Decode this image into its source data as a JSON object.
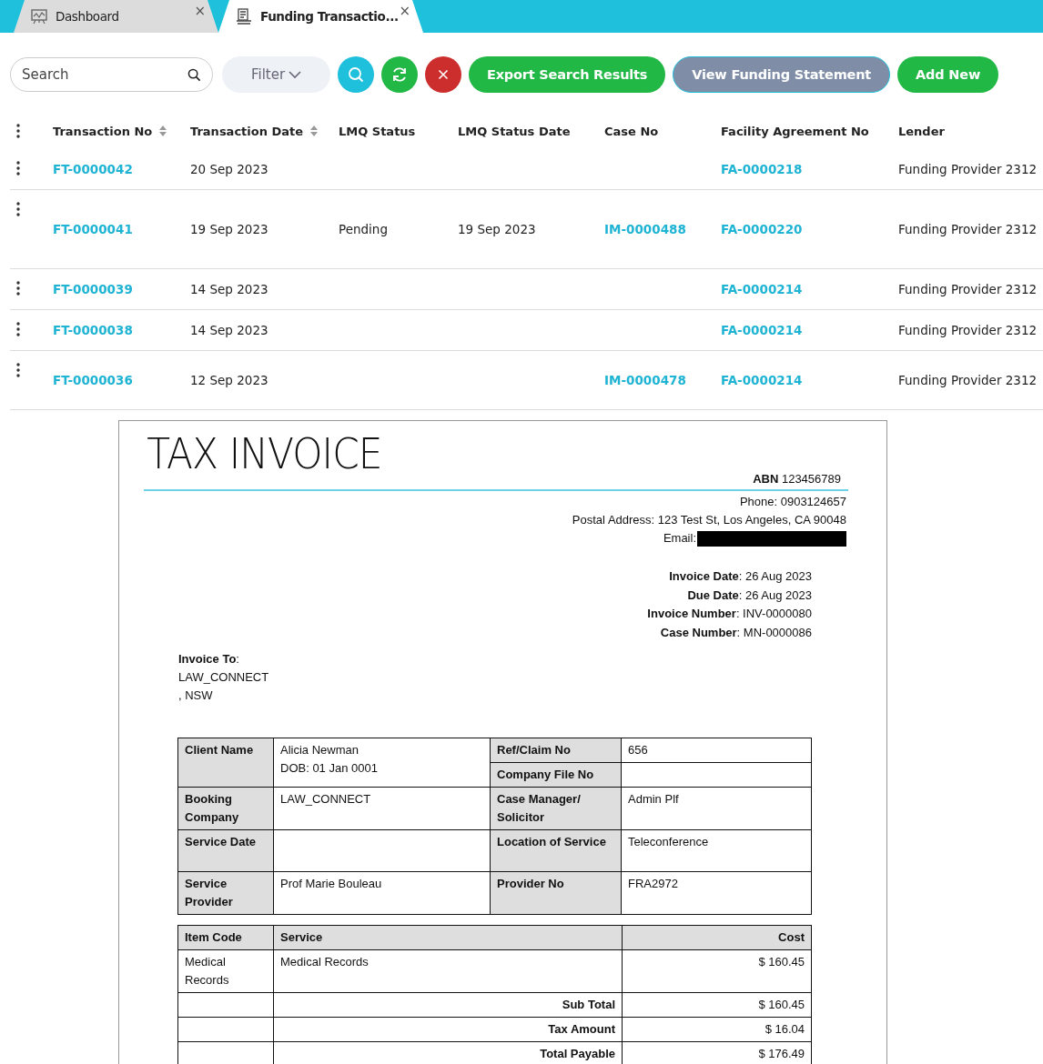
{
  "tabs": [
    {
      "label": "Dashboard",
      "close": "×",
      "selected": false
    },
    {
      "label": "Funding Transactio...",
      "close": "×",
      "selected": true
    }
  ],
  "toolbar": {
    "search": {
      "placeholder": "Search"
    },
    "filter": "Filter",
    "buttons": [
      {
        "label": "Export Search Results",
        "kind": "green"
      },
      {
        "label": "View Funding Statement",
        "kind": "grey"
      },
      {
        "label": "Add New",
        "kind": "green"
      }
    ]
  },
  "table": {
    "columns": [
      {
        "label": "Transaction No",
        "sortable": true
      },
      {
        "label": "Transaction Date",
        "sortable": true
      },
      {
        "label": "LMQ Status",
        "sortable": false
      },
      {
        "label": "LMQ Status Date",
        "sortable": false
      },
      {
        "label": "Case No",
        "sortable": false
      },
      {
        "label": "Facility Agreement No",
        "sortable": false
      },
      {
        "label": "Lender",
        "sortable": false
      }
    ],
    "rows": [
      {
        "transaction_no": "FT-0000042",
        "transaction_date": "20 Sep 2023",
        "facility_agreement_no": "FA-0000218",
        "lender": "Funding Provider 2312"
      },
      {
        "transaction_no": "FT-0000041",
        "transaction_date": "19 Sep 2023",
        "lmq_status": "Pending",
        "lmq_status_date": "19 Sep 2023",
        "case_no": "IM-0000488",
        "facility_agreement_no": "FA-0000220",
        "lender": "Funding Provider 2312"
      },
      {
        "transaction_no": "FT-0000039",
        "transaction_date": "14 Sep 2023",
        "facility_agreement_no": "FA-0000214",
        "lender": "Funding Provider 2312"
      },
      {
        "transaction_no": "FT-0000038",
        "transaction_date": "14 Sep 2023",
        "facility_agreement_no": "FA-0000214",
        "lender": "Funding Provider 2312"
      },
      {
        "transaction_no": "FT-0000036",
        "transaction_date": "12 Sep 2023",
        "case_no": "IM-0000478",
        "facility_agreement_no": "FA-0000214",
        "lender": "Funding Provider 2312"
      }
    ]
  },
  "invoice": {
    "title": "TAX INVOICE",
    "abn": "**ABN** 123456789",
    "contact": [
      "Phone: 0903124657",
      "Postal Address: 123 Test St, Los Angeles, CA 90048"
    ],
    "email_label": "Email:",
    "email_redacted": true,
    "meta": [
      "**Invoice Date**: 26 Aug 2023",
      "**Due Date**: 26 Aug 2023",
      "**Invoice Number**: INV-0000080",
      "**Case Number**: MN-0000086"
    ],
    "invoice_to": {
      "label": "**Invoice To**:",
      "lines": [
        "LAW_CONNECT",
        ", NSW"
      ]
    },
    "details": [
      {
        "label": "Client Name",
        "values": [
          "Alicia Newman",
          "DOB: 01 Jan 0001"
        ],
        "right": [
          {
            "label": "Ref/Claim No",
            "value": "656"
          },
          {
            "label": "Company File No"
          }
        ]
      },
      {
        "label": "Booking Company",
        "values": [
          "LAW_CONNECT"
        ],
        "right": [
          {
            "label": "Case Manager/ Solicitor",
            "value": "Admin Plf"
          }
        ]
      },
      {
        "label": "Service Date",
        "right": [
          {
            "label": "Location of Service",
            "value": "Teleconference"
          }
        ]
      },
      {
        "label": "Service Provider",
        "values": [
          "Prof Marie Bouleau"
        ],
        "right": [
          {
            "label": "Provider No",
            "value": "FRA2972"
          }
        ]
      }
    ],
    "items": {
      "columns": [
        "Item Code",
        "Service",
        "Cost"
      ],
      "rows": [
        {
          "item_code": "Medical Records",
          "service": "Medical Records",
          "cost": "$ 160.45"
        }
      ],
      "totals": [
        {
          "label": "Sub Total",
          "value": "$ 160.45"
        },
        {
          "label": "Tax Amount",
          "value": "$ 16.04"
        },
        {
          "label": "Total Payable",
          "value": "$ 176.49"
        }
      ]
    }
  }
}
